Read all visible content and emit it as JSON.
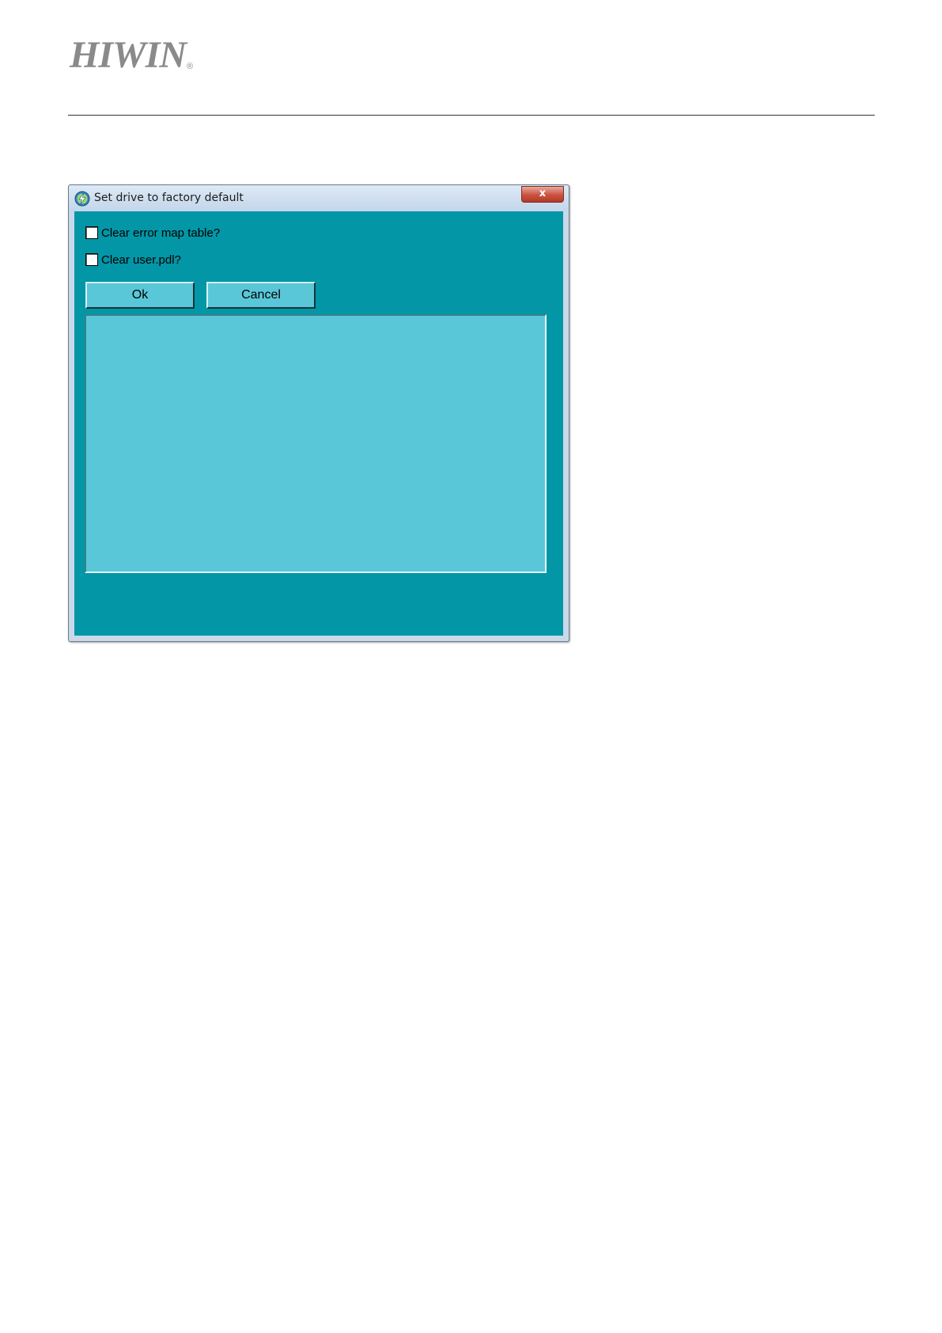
{
  "header": {
    "logo_text": "HIWIN",
    "logo_mark": "®",
    "logo_color": "#8a8a8a"
  },
  "dialog": {
    "title": "Set drive to factory default",
    "app_icon": "lightning-icon",
    "close_label": "x",
    "background_color": "#0396a6",
    "control_color": "#5ac7d8",
    "checkboxes": [
      {
        "label": "Clear error map table?",
        "checked": false
      },
      {
        "label": "Clear user.pdl?",
        "checked": false
      }
    ],
    "buttons": {
      "ok_label": "Ok",
      "cancel_label": "Cancel"
    },
    "output_text": ""
  }
}
